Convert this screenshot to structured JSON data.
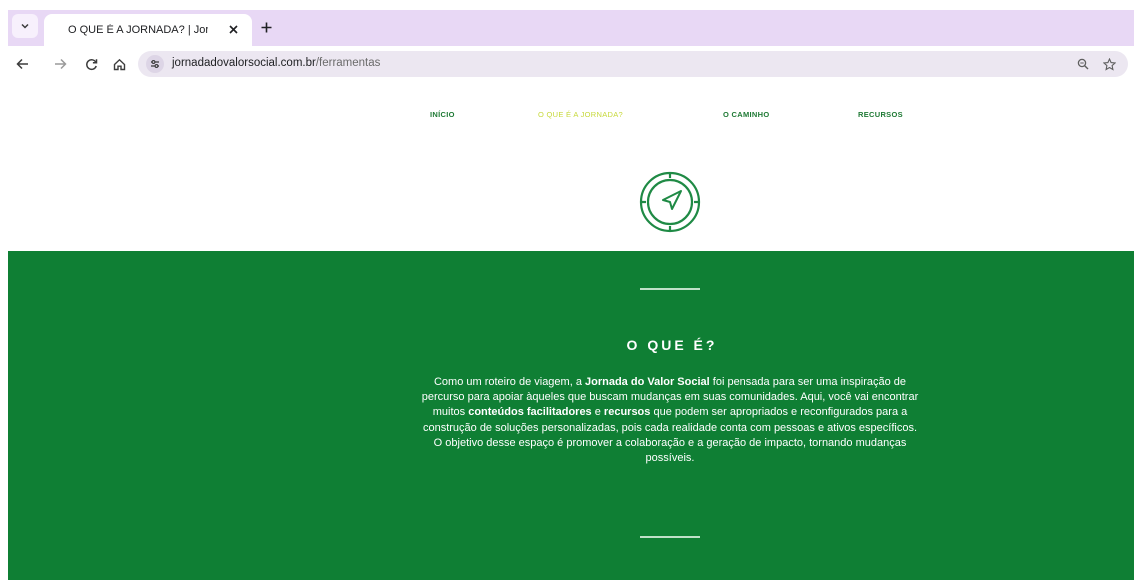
{
  "browser": {
    "tab_title": "O QUE É A JORNADA? | Jornad",
    "url_domain": "jornadadovalorsocial.com.br",
    "url_path": "/ferramentas",
    "icons": [
      "tab-search-icon",
      "close-icon",
      "new-tab-icon",
      "back-icon",
      "forward-icon",
      "reload-icon",
      "home-icon",
      "site-info-icon",
      "zoom-icon",
      "bookmark-star-icon"
    ],
    "colors": {
      "tabstrip": "#e8d8f5",
      "omnibox": "#ece7f1"
    }
  },
  "site": {
    "nav": {
      "home": "INÍCIO",
      "about": "O QUE É A JORNADA?",
      "path": "O CAMINHO",
      "resources": "RECURSOS"
    },
    "logo_icon": "compass-icon",
    "hero": {
      "title": "O QUE É?",
      "text": {
        "p1": "Como um roteiro de viagem, a ",
        "b1": "Jornada do Valor Social",
        "p2": " foi pensada para ser uma inspiração de percurso para apoiar àqueles que buscam mudanças em suas comunidades. Aqui, você vai encontrar muitos ",
        "b2": "conteúdos facilitadores",
        "p3": " e ",
        "b3": "recursos",
        "p4": " que podem ser apropriados e reconfigurados para a construção de soluções personalizadas, pois cada realidade conta com pessoas e ativos específicos. O objetivo desse espaço é promover a colaboração e a geração de impacto, tornando mudanças possíveis."
      }
    },
    "colors": {
      "green": "#0f7f34",
      "nav_text": "#1f7a35",
      "nav_active": "#c7d93b"
    }
  }
}
